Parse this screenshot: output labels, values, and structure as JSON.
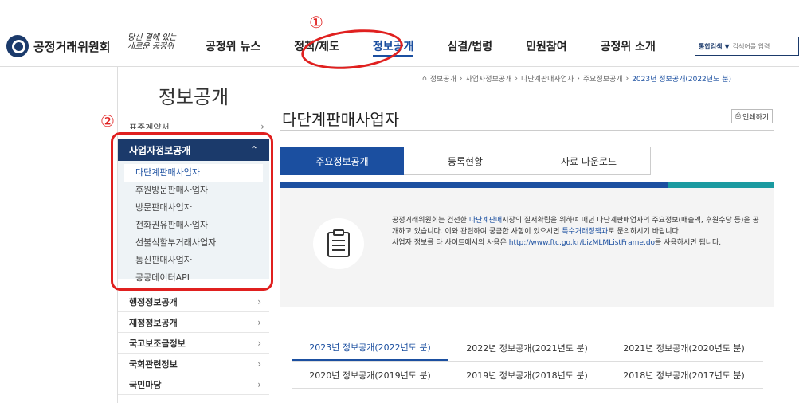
{
  "header": {
    "logo_text": "공정거래위원회",
    "slogan_line1": "당신 곁에 있는",
    "slogan_line2": "새로운 공정위",
    "nav": [
      {
        "label": "공정위 뉴스"
      },
      {
        "label": "정책/제도"
      },
      {
        "label": "정보공개"
      },
      {
        "label": "심결/법령"
      },
      {
        "label": "민원참여"
      },
      {
        "label": "공정위 소개"
      }
    ],
    "active_nav": "정보공개",
    "search": {
      "scope": "통합검색",
      "placeholder": "검색어를 입력"
    }
  },
  "sidebar": {
    "title": "정보공개",
    "cut_item": "표준계약서",
    "open_group": {
      "label": "사업자정보공개",
      "items": [
        {
          "label": "다단계판매사업자"
        },
        {
          "label": "후원방문판매사업자"
        },
        {
          "label": "방문판매사업자"
        },
        {
          "label": "전화권유판매사업자"
        },
        {
          "label": "선불식할부거래사업자"
        },
        {
          "label": "통신판매사업자"
        },
        {
          "label": "공공데이터API"
        }
      ],
      "active_item": "다단계판매사업자"
    },
    "other_groups": [
      {
        "label": "행정정보공개"
      },
      {
        "label": "재정정보공개"
      },
      {
        "label": "국고보조금정보"
      },
      {
        "label": "국회관련정보"
      },
      {
        "label": "국민마당"
      }
    ]
  },
  "breadcrumb": [
    "정보공개",
    "사업자정보공개",
    "다단계판매사업자",
    "주요정보공개",
    "2023년 정보공개(2022년도 분)"
  ],
  "page": {
    "title": "다단계판매사업자",
    "print_label": "인쇄하기"
  },
  "tabs": [
    {
      "label": "주요정보공개"
    },
    {
      "label": "등록현황"
    },
    {
      "label": "자료 다운로드"
    }
  ],
  "active_tab": "주요정보공개",
  "info": {
    "p1_a": "공정거래위원회는 건전한 ",
    "p1_link": "다단계판매",
    "p1_b": "시장의 질서확립을 위하여 매년 다단계판매업자의 주요정보(매출액, 후원수당 등)을 공개하고 있습니다. 이와 관련하여 궁금한 사항이 있으시면 ",
    "p1_link2": "특수거래정책과",
    "p1_c": "로 문의하시기 바랍니다.",
    "p2_a": "사업자 정보를 타 사이트에서의 사용은 ",
    "p2_url": "http://www.ftc.go.kr/bizMLMListFrame.do",
    "p2_b": "를 사용하시면 됩니다."
  },
  "year_tabs": [
    [
      "2023년 정보공개(2022년도 분)",
      "2022년 정보공개(2021년도 분)",
      "2021년 정보공개(2020년도 분)"
    ],
    [
      "2020년 정보공개(2019년도 분)",
      "2019년 정보공개(2018년도 분)",
      "2018년 정보공개(2017년도 분)"
    ]
  ],
  "active_year": "2023년 정보공개(2022년도 분)",
  "annotations": {
    "one": "①",
    "two": "②"
  },
  "colors": {
    "brand": "#1b3a6b",
    "accent": "#1b4fa0",
    "teal": "#1a9aa0",
    "annotation": "#e0201f"
  }
}
